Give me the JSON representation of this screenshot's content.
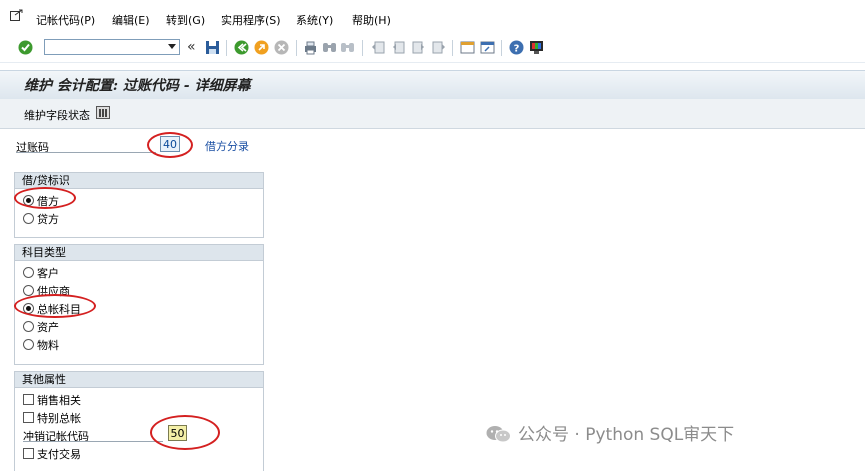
{
  "menu": {
    "items": [
      "记帐代码(P)",
      "编辑(E)",
      "转到(G)",
      "实用程序(S)",
      "系统(Y)",
      "帮助(H)"
    ]
  },
  "toolbar": {
    "command_value": "",
    "back_glyph": "«"
  },
  "screen": {
    "title": "维护 会计配置: 过账代码 - 详细屏幕",
    "app_button_label": "维护字段状态"
  },
  "posting_key": {
    "label": "过账码",
    "value": "40",
    "description": "借方分录"
  },
  "debit_credit_group": {
    "title": "借/贷标识",
    "options": [
      "借方",
      "贷方"
    ],
    "selected": "借方"
  },
  "account_type_group": {
    "title": "科目类型",
    "options": [
      "客户",
      "供应商",
      "总帐科目",
      "资产",
      "物料"
    ],
    "selected": "总帐科目"
  },
  "other_attributes_group": {
    "title": "其他属性",
    "sales_related_label": "销售相关",
    "special_gl_label": "特别总帐",
    "reversal_code_label": "冲销记帐代码",
    "reversal_code_value": "50",
    "payment_transaction_label": "支付交易"
  },
  "watermark": {
    "text": "公众号 · Python SQL审天下"
  },
  "colors": {
    "annotation_circle": "#d42020",
    "title_gradient_top": "#f2f6f9",
    "group_header": "#dde5ec",
    "link_blue": "#1a4fa3"
  }
}
